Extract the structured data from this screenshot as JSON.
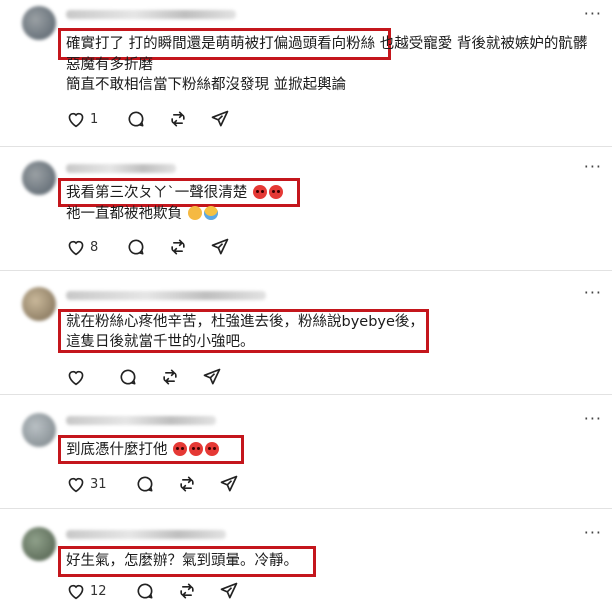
{
  "comments": [
    {
      "lines": [
        "確實打了 打的瞬間還是萌萌被打偏過頭看向粉絲 也越受寵愛 背後就被嫉妒的骯髒",
        "惡魔有多折磨",
        "簡直不敢相信當下粉絲都沒發現 並掀起輿論"
      ],
      "likes": "1",
      "replies": "",
      "reposts": ""
    },
    {
      "lines": [
        "我看第三次ㄆㄚˋ一聲很清楚",
        "祂一直都被祂欺負"
      ],
      "likes": "8",
      "replies": "",
      "reposts": ""
    },
    {
      "lines": [
        "就在粉絲心疼他辛苦，杜強進去後，粉絲說byebye後，",
        "這隻日後就當千世的小強吧。"
      ],
      "likes": "",
      "replies": "",
      "reposts": ""
    },
    {
      "lines": [
        "到底憑什麼打他"
      ],
      "likes": "31",
      "replies": "",
      "reposts": ""
    },
    {
      "lines": [
        "好生氣，怎麼辦？氣到頭暈。冷靜。"
      ],
      "likes": "12",
      "replies": "",
      "reposts": ""
    }
  ],
  "colors": {
    "highlight": "#c4161c",
    "divider": "#e2e2e2"
  },
  "icons": [
    "heart-icon",
    "comment-icon",
    "repost-icon",
    "share-icon",
    "more-icon"
  ]
}
